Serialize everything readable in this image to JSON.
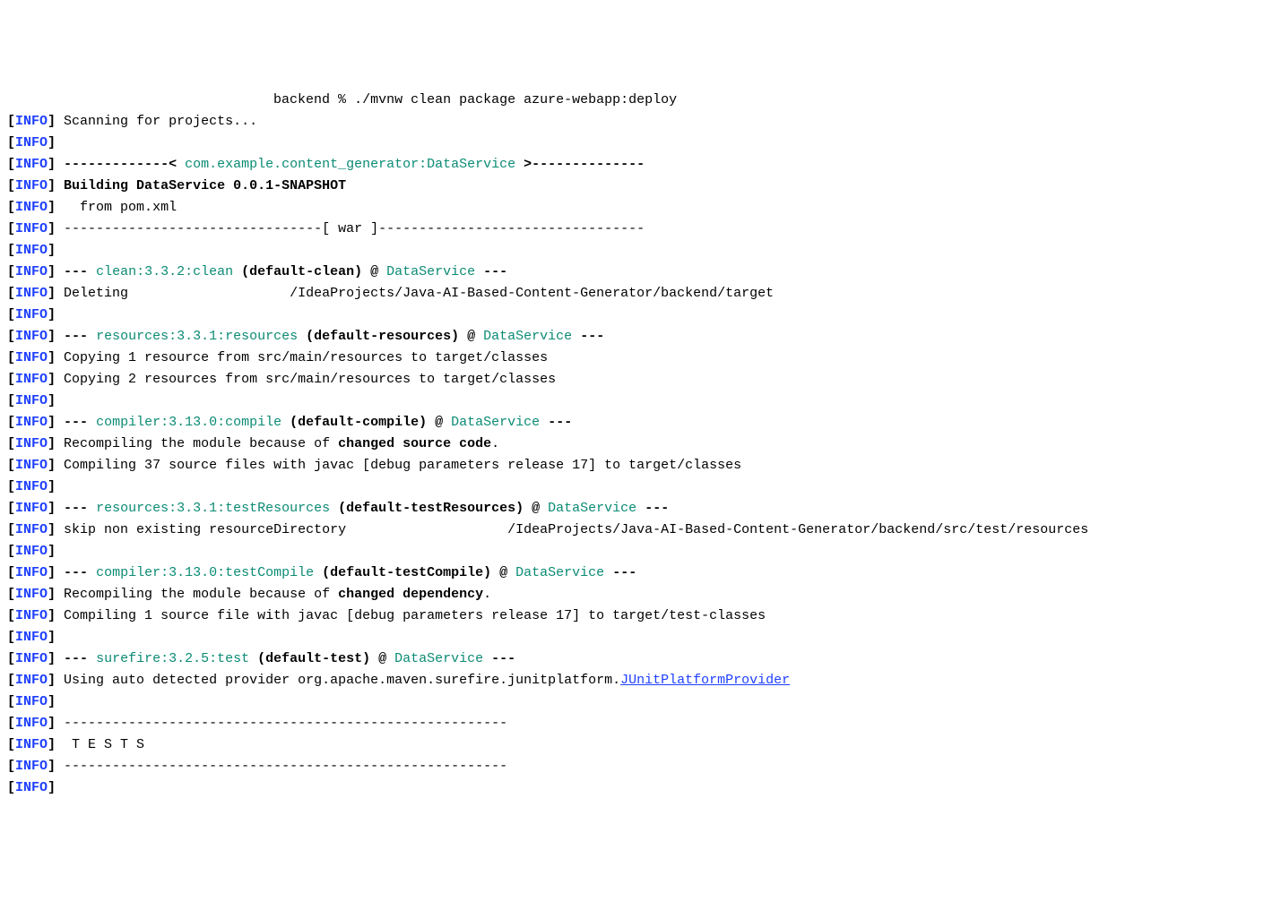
{
  "lines": [
    {
      "type": "command",
      "prefix": "                                 ",
      "text": "backend % ./mvnw clean package azure-webapp:deploy"
    },
    {
      "type": "info_plain",
      "text": "Scanning for projects..."
    },
    {
      "type": "info_plain",
      "text": ""
    },
    {
      "type": "info_header_proj",
      "pre": "-------------< ",
      "green": "com.example.content_generator:DataService",
      "post": " >--------------"
    },
    {
      "type": "info_bold",
      "text": "Building DataService 0.0.1-SNAPSHOT"
    },
    {
      "type": "info_plain",
      "text": "  from pom.xml"
    },
    {
      "type": "info_plain",
      "text": "--------------------------------[ war ]---------------------------------"
    },
    {
      "type": "info_plain",
      "text": ""
    },
    {
      "type": "info_goal",
      "pre": "--- ",
      "goal": "clean:3.3.2:clean",
      "exec": " (default-clean)",
      "at": " @ ",
      "service": "DataService",
      "post": " ---"
    },
    {
      "type": "info_plain",
      "text": "Deleting                    /IdeaProjects/Java-AI-Based-Content-Generator/backend/target"
    },
    {
      "type": "info_plain",
      "text": ""
    },
    {
      "type": "info_goal",
      "pre": "--- ",
      "goal": "resources:3.3.1:resources",
      "exec": " (default-resources)",
      "at": " @ ",
      "service": "DataService",
      "post": " ---"
    },
    {
      "type": "info_plain",
      "text": "Copying 1 resource from src/main/resources to target/classes"
    },
    {
      "type": "info_plain",
      "text": "Copying 2 resources from src/main/resources to target/classes"
    },
    {
      "type": "info_plain",
      "text": ""
    },
    {
      "type": "info_goal",
      "pre": "--- ",
      "goal": "compiler:3.13.0:compile",
      "exec": " (default-compile)",
      "at": " @ ",
      "service": "DataService",
      "post": " ---"
    },
    {
      "type": "info_mixed",
      "pre": "Recompiling the module because of ",
      "bold": "changed source code",
      "post": "."
    },
    {
      "type": "info_plain",
      "text": "Compiling 37 source files with javac [debug parameters release 17] to target/classes"
    },
    {
      "type": "info_plain",
      "text": ""
    },
    {
      "type": "info_goal",
      "pre": "--- ",
      "goal": "resources:3.3.1:testResources",
      "exec": " (default-testResources)",
      "at": " @ ",
      "service": "DataService",
      "post": " ---"
    },
    {
      "type": "info_plain",
      "text": "skip non existing resourceDirectory                    /IdeaProjects/Java-AI-Based-Content-Generator/backend/src/test/resources"
    },
    {
      "type": "info_plain",
      "text": ""
    },
    {
      "type": "info_goal",
      "pre": "--- ",
      "goal": "compiler:3.13.0:testCompile",
      "exec": " (default-testCompile)",
      "at": " @ ",
      "service": "DataService",
      "post": " ---"
    },
    {
      "type": "info_mixed",
      "pre": "Recompiling the module because of ",
      "bold": "changed dependency",
      "post": "."
    },
    {
      "type": "info_plain",
      "text": "Compiling 1 source file with javac [debug parameters release 17] to target/test-classes"
    },
    {
      "type": "info_plain",
      "text": ""
    },
    {
      "type": "info_goal",
      "pre": "--- ",
      "goal": "surefire:3.2.5:test",
      "exec": " (default-test)",
      "at": " @ ",
      "service": "DataService",
      "post": " ---"
    },
    {
      "type": "info_link",
      "pre": "Using auto detected provider org.apache.maven.surefire.junitplatform.",
      "link": "JUnitPlatformProvider"
    },
    {
      "type": "info_plain",
      "text": ""
    },
    {
      "type": "info_plain",
      "text": "-------------------------------------------------------"
    },
    {
      "type": "info_plain",
      "text": " T E S T S"
    },
    {
      "type": "info_plain",
      "text": "-------------------------------------------------------"
    },
    {
      "type": "info_plain",
      "text": ""
    }
  ],
  "infoLabel": "INFO",
  "bracketOpen": "[",
  "bracketClose": "] "
}
